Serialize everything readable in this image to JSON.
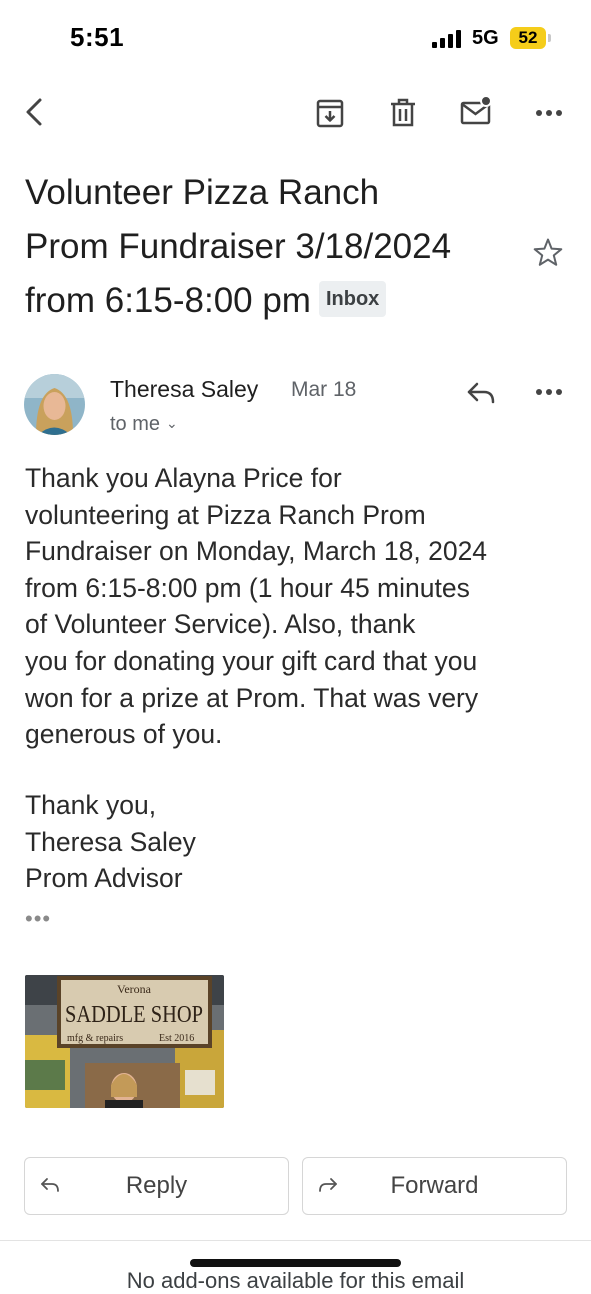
{
  "status_bar": {
    "time": "5:51",
    "network": "5G",
    "battery": "52"
  },
  "toolbar": {
    "icons": [
      "back-icon",
      "archive-icon",
      "trash-icon",
      "mark-unread-icon",
      "more-icon"
    ]
  },
  "email": {
    "subject": "Volunteer Pizza Ranch Prom Fundraiser 3/18/2024 from 6:15-8:00 pm",
    "subject_lines": [
      "Volunteer Pizza Ranch",
      "Prom Fundraiser 3/18/2024",
      "from 6:15-8:00 pm"
    ],
    "label": "Inbox",
    "sender": "Theresa Saley",
    "date": "Mar 18",
    "recipient": "to me",
    "body_lines": [
      "Thank you Alayna Price  for",
      "volunteering at Pizza Ranch Prom",
      "Fundraiser on Monday, March 18, 2024",
      "from 6:15-8:00 pm (1 hour 45 minutes",
      "of Volunteer Service). Also, thank",
      "you for donating your gift card that you",
      "won for a prize at Prom. That was very",
      "generous of you."
    ],
    "signature": [
      "Thank you,",
      "Theresa Saley",
      "Prom Advisor"
    ],
    "trimmed": "•••",
    "attachment_sign": {
      "line1": "Verona",
      "line2": "SADDLE SHOP",
      "left": "mfg & repairs",
      "right": "Est 2016"
    }
  },
  "actions": {
    "reply": "Reply",
    "forward": "Forward"
  },
  "footer": {
    "addons_text": "No add-ons available for this email"
  },
  "colors": {
    "battery": "#f5cd1a",
    "text": "#1f1f1f",
    "secondary": "#5f6368",
    "chip_bg": "#eceff1"
  }
}
